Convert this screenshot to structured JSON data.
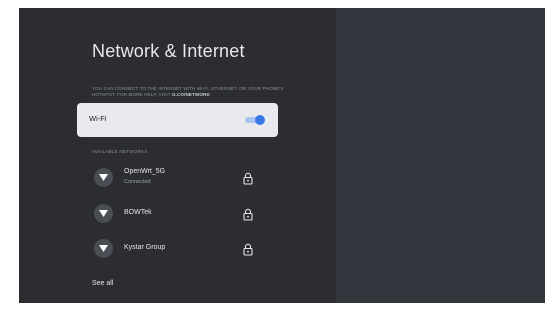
{
  "page": {
    "title": "Network & Internet",
    "description": {
      "text": "YOU CAN CONNECT TO THE INTERNET WITH WI-FI, ETHERNET, OR YOUR PHONE'S HOTSPOT. FOR MORE HELP, VISIT",
      "link": "G.CO/NETWORK"
    }
  },
  "wifi": {
    "label": "Wi-Fi",
    "enabled": true,
    "toggle_color": "#3b78e7"
  },
  "available": {
    "section_label": "AVAILABLE NETWORKS",
    "networks": [
      {
        "name": "OpenWrt_5G",
        "status": "Connected",
        "icon": "wifi-icon",
        "secured": true
      },
      {
        "name": "BOWTek",
        "status": "",
        "icon": "wifi-icon",
        "secured": true
      },
      {
        "name": "Kystar Group",
        "status": "",
        "icon": "wifi-icon",
        "secured": true
      }
    ]
  },
  "see_all": "See all",
  "colors": {
    "background": "#2b2d31",
    "right_pane": "#32353b",
    "card": "#e8eaed",
    "accent": "#3b78e7"
  }
}
